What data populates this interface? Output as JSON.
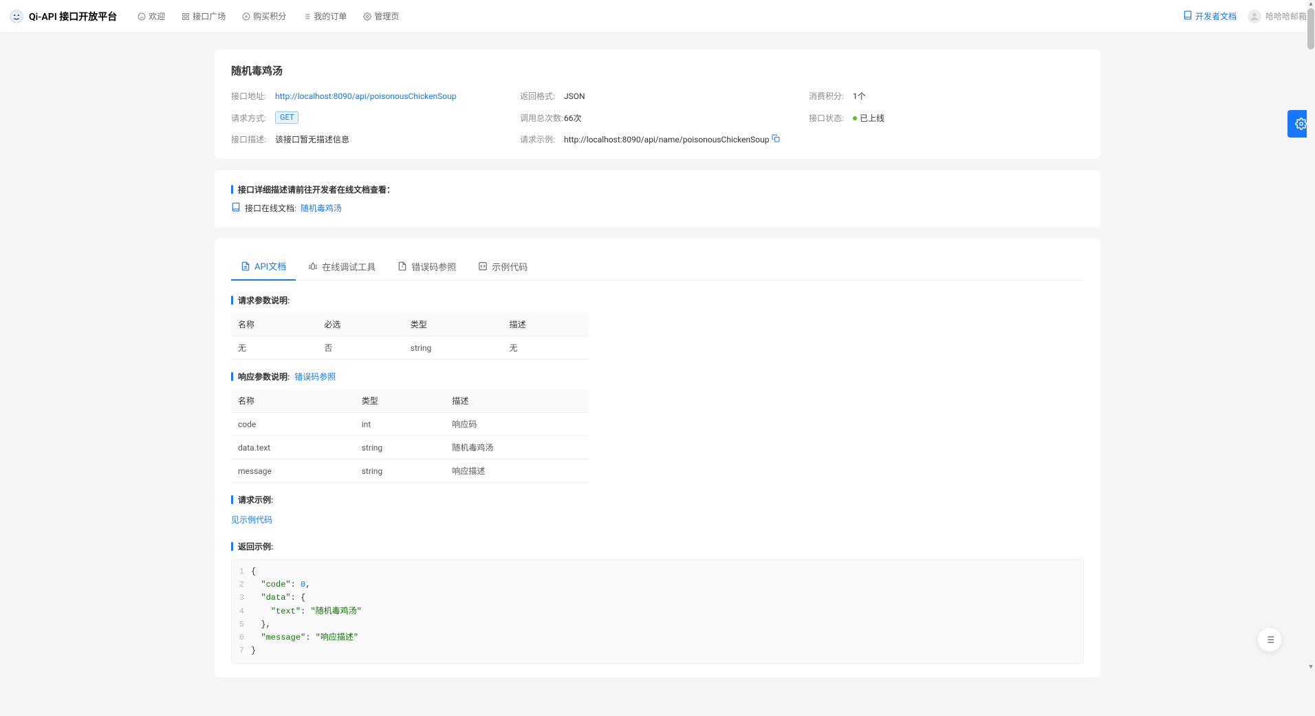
{
  "header": {
    "appTitle": "Qi-API 接口开放平台",
    "nav": [
      {
        "label": "欢迎"
      },
      {
        "label": "接口广场"
      },
      {
        "label": "购买积分"
      },
      {
        "label": "我的订单"
      },
      {
        "label": "管理页"
      }
    ],
    "devDocs": "开发者文档",
    "username": "哈哈哈邮箱"
  },
  "page": {
    "title": "随机毒鸡汤",
    "info": {
      "urlLabel": "接口地址:",
      "url": "http://localhost:8090/api/poisonousChickenSoup",
      "returnFormatLabel": "返回格式:",
      "returnFormat": "JSON",
      "costLabel": "消费积分:",
      "cost": "1个",
      "methodLabel": "请求方式:",
      "method": "GET",
      "callCountLabel": "调用总次数:",
      "callCount": "66次",
      "statusLabel": "接口状态:",
      "status": "已上线",
      "descLabel": "接口描述:",
      "desc": "该接口暂无描述信息",
      "reqExampleLabel": "请求示例:",
      "reqExample": "http://localhost:8090/api/name/poisonousChickenSoup"
    },
    "docLinkSection": {
      "heading": "接口详细描述请前往开发者在线文档查看：",
      "label": "接口在线文档:",
      "linkText": "随机毒鸡汤"
    },
    "tabs": [
      {
        "label": "API文档",
        "active": true
      },
      {
        "label": "在线调试工具"
      },
      {
        "label": "错误码参照"
      },
      {
        "label": "示例代码"
      }
    ],
    "reqParamsHeading": "请求参数说明:",
    "reqParamsTable": {
      "headers": [
        "名称",
        "必选",
        "类型",
        "描述"
      ],
      "rows": [
        [
          "无",
          "否",
          "string",
          "无"
        ]
      ]
    },
    "respParamsHeading": "响应参数说明:",
    "respParamsLink": "错误码参照",
    "respParamsTable": {
      "headers": [
        "名称",
        "类型",
        "描述"
      ],
      "rows": [
        [
          "code",
          "int",
          "响应码"
        ],
        [
          "data.text",
          "string",
          "随机毒鸡汤"
        ],
        [
          "message",
          "string",
          "响应描述"
        ]
      ]
    },
    "reqExampleHeading": "请求示例:",
    "reqExampleLink": "见示例代码",
    "respExampleHeading": "返回示例:",
    "codeLines": [
      {
        "n": "1",
        "tokens": [
          {
            "t": "{",
            "c": "punct"
          }
        ]
      },
      {
        "n": "2",
        "tokens": [
          {
            "t": "  ",
            "c": "punct"
          },
          {
            "t": "\"code\"",
            "c": "key"
          },
          {
            "t": ": ",
            "c": "punct"
          },
          {
            "t": "0",
            "c": "num"
          },
          {
            "t": ",",
            "c": "punct"
          }
        ]
      },
      {
        "n": "3",
        "tokens": [
          {
            "t": "  ",
            "c": "punct"
          },
          {
            "t": "\"data\"",
            "c": "key"
          },
          {
            "t": ": {",
            "c": "punct"
          }
        ]
      },
      {
        "n": "4",
        "tokens": [
          {
            "t": "    ",
            "c": "punct"
          },
          {
            "t": "\"text\"",
            "c": "key"
          },
          {
            "t": ": ",
            "c": "punct"
          },
          {
            "t": "\"随机毒鸡汤\"",
            "c": "str"
          }
        ]
      },
      {
        "n": "5",
        "tokens": [
          {
            "t": "  },",
            "c": "punct"
          }
        ]
      },
      {
        "n": "6",
        "tokens": [
          {
            "t": "  ",
            "c": "punct"
          },
          {
            "t": "\"message\"",
            "c": "key"
          },
          {
            "t": ": ",
            "c": "punct"
          },
          {
            "t": "\"响应描述\"",
            "c": "str"
          }
        ]
      },
      {
        "n": "7",
        "tokens": [
          {
            "t": "}",
            "c": "punct"
          }
        ]
      }
    ]
  }
}
